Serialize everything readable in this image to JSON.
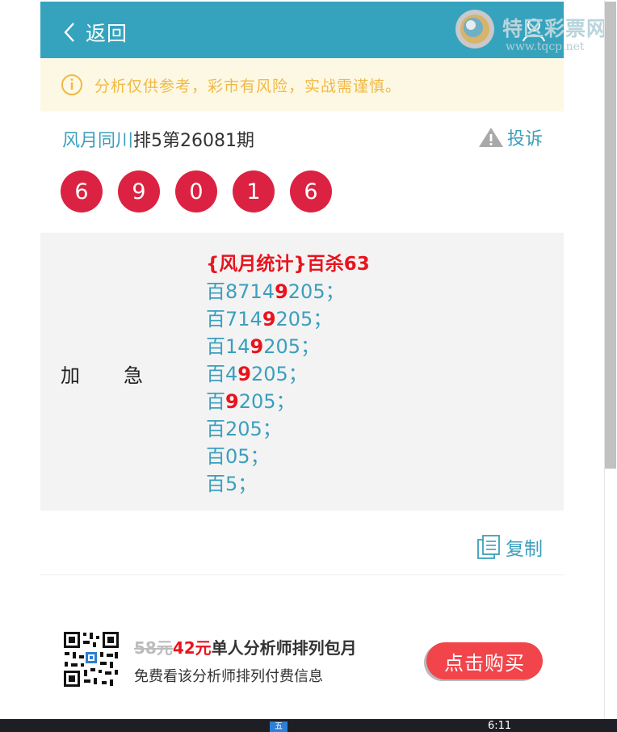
{
  "header": {
    "back_label": "返回",
    "logo_name": "特区彩票网",
    "logo_url": "www.tqcp.net"
  },
  "notice": {
    "text": "分析仅供参考，彩市有风险，实战需谨慎。"
  },
  "post": {
    "author": "风月同川",
    "issue": "排5第26081期",
    "report_label": "投诉",
    "numbers": [
      "6",
      "9",
      "0",
      "1",
      "6"
    ]
  },
  "content": {
    "label": "加急",
    "heading": "{风月统计}百杀63",
    "lines": [
      {
        "pre": "百8714",
        "hl": "9",
        "post": "205；"
      },
      {
        "pre": "百714",
        "hl": "9",
        "post": "205；"
      },
      {
        "pre": "百14",
        "hl": "9",
        "post": "205；"
      },
      {
        "pre": "百4",
        "hl": "9",
        "post": "205；"
      },
      {
        "pre": "百",
        "hl": "9",
        "post": "205；"
      },
      {
        "pre": "百205；",
        "hl": "",
        "post": ""
      },
      {
        "pre": "百05；",
        "hl": "",
        "post": ""
      },
      {
        "pre": "百5；",
        "hl": "",
        "post": ""
      }
    ]
  },
  "copy_label": "复制",
  "promo": {
    "old_price": "58元",
    "new_price": "42元",
    "title": "单人分析师排列包月",
    "subtitle": "免费看该分析师排列付费信息",
    "buy_label": "点击购买"
  },
  "taskbar": {
    "icon_label": "五",
    "time": "6:11"
  },
  "colors": {
    "header": "#35a3bd",
    "accent": "#3b9fbd",
    "ball": "#dc2242",
    "warning": "#f0b945",
    "highlight": "#e8141d",
    "buy": "#f1454b"
  }
}
